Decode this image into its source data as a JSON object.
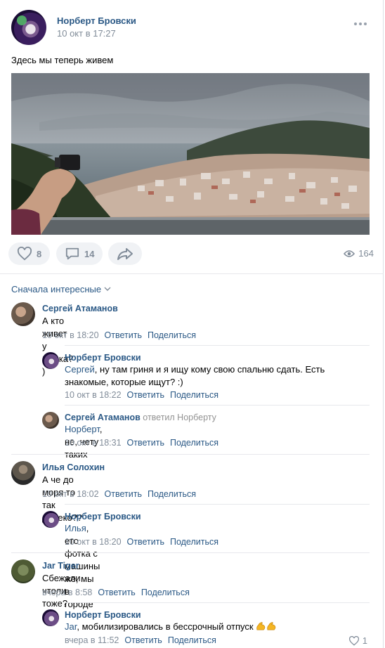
{
  "post": {
    "author": "Норберт Бровски",
    "date": "10 окт в 17:27",
    "text": "Здесь мы теперь живем",
    "likes": "8",
    "comments": "14",
    "views": "164"
  },
  "sort_label": "Сначала интересные",
  "comments": [
    {
      "name": "Сергей Атаманов",
      "text": "А кто живет у Ярика? )",
      "time": "10 окт в 18:20",
      "reply": "Ответить",
      "share": "Поделиться"
    },
    {
      "name": "Норберт Бровски",
      "mention": "Сергей",
      "text_line1": ", ну там гриня и я ищу кому свою спальню сдать. Есть",
      "text_line2": "знакомые, которые ищут? :)",
      "time": "10 окт в 18:22",
      "reply": "Ответить",
      "share": "Поделиться"
    },
    {
      "name": "Сергей Атаманов",
      "replied": "ответил Норберту",
      "mention": "Норберт",
      "text": ", не, нету таких",
      "time": "10 окт в 18:31",
      "reply": "Ответить",
      "share": "Поделиться"
    },
    {
      "name": "Илья Солохин",
      "text": "А че до моря то так далеко??",
      "time": "10 окт в 18:02",
      "reply": "Ответить",
      "share": "Поделиться"
    },
    {
      "name": "Норберт Бровски",
      "mention": "Илья",
      "text": ", ето фотка с машины же, мы в городе",
      "time": "10 окт в 18:20",
      "reply": "Ответить",
      "share": "Поделиться"
    },
    {
      "name": "Jar Tiger",
      "text": "Сбежали чтоли тоже?",
      "time": "вчера в 8:58",
      "reply": "Ответить",
      "share": "Поделиться"
    },
    {
      "name": "Норберт Бровски",
      "mention": "Jar",
      "text": ", мобилизировались в бессрочный отпуск",
      "time": "вчера в 11:52",
      "reply": "Ответить",
      "share": "Поделиться",
      "likes": "1"
    }
  ],
  "icons": [
    "more-icon",
    "heart-icon",
    "comment-icon",
    "share-icon",
    "eye-icon",
    "chevron-down-icon",
    "muscle-emoji-icon"
  ],
  "colors": {
    "link": "#2a5885",
    "muted": "#818c99",
    "button_bg": "#f0f2f5"
  }
}
